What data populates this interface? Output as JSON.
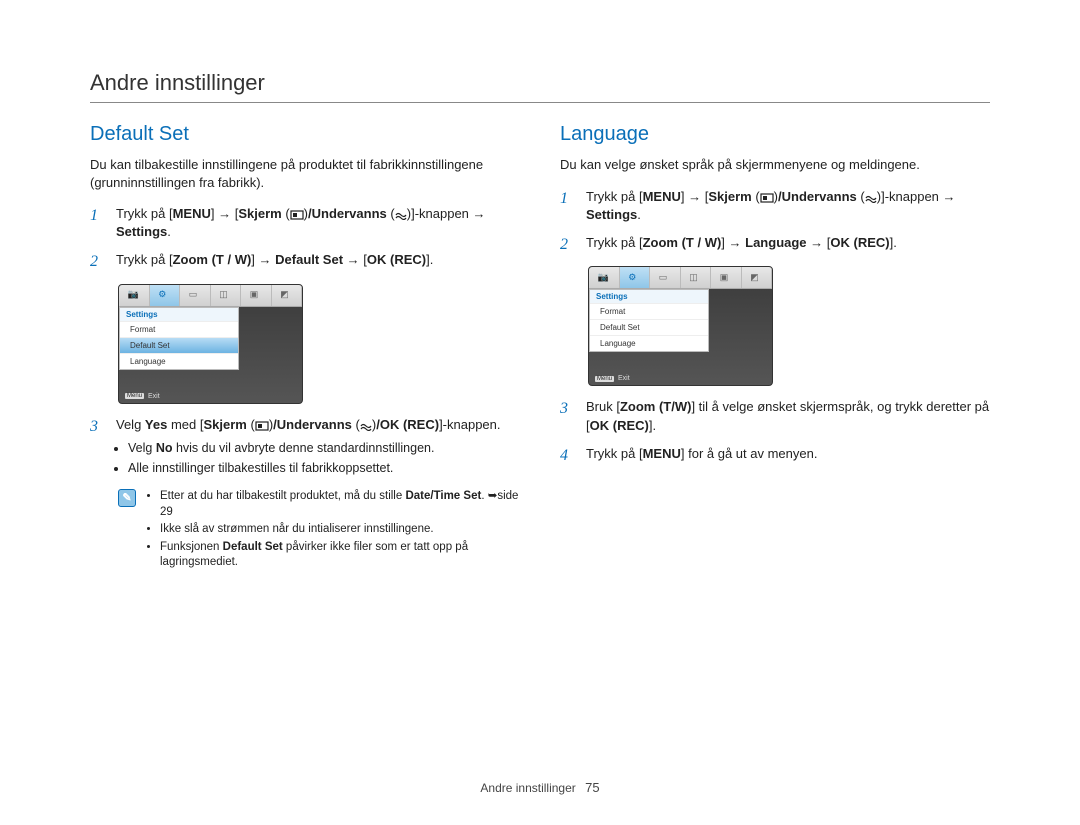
{
  "page_header": "Andre innstillinger",
  "footer": {
    "label": "Andre innstillinger",
    "page": "75"
  },
  "left": {
    "title": "Default Set",
    "intro": "Du kan tilbakestille innstillingene på produktet til fabrikkinnstillingene (grunninnstillingen fra fabrikk).",
    "step1_prefix": "Trykk på [",
    "menu": "MENU",
    "step1_mid1": "] → [",
    "skjerm": "Skjerm",
    "step1_underv": "/Undervanns",
    "step1_tail": "]-knappen → ",
    "settings": "Settings",
    "period": ".",
    "step2_prefix": "Trykk på [",
    "zoom": "Zoom (T / W)",
    "step2_mid": "] → ",
    "default_set": "Default Set",
    "step2_mid2": " → [",
    "okrec": "OK (REC)",
    "step2_tail": "].",
    "menu_label": "Settings",
    "menu_items": [
      "Format",
      "Default Set",
      "Language"
    ],
    "menu_selected": 1,
    "menu_exit": "Exit",
    "menu_exit_tag": "Menu",
    "step3_prefix": "Velg ",
    "yes": "Yes",
    "step3_mid": " med [",
    "step3_okrec": "/OK (REC)",
    "step3_tail": "]-knappen.",
    "step3_bullets": [
      {
        "pre": "Velg ",
        "bold": "No",
        "post": " hvis du vil avbryte denne standardinnstillingen."
      },
      {
        "text": "Alle innstillinger tilbakestilles til fabrikkoppsettet."
      }
    ],
    "notes": [
      {
        "pre": "Etter at du har tilbakestilt produktet, må du stille ",
        "bold": "Date/Time Set",
        "post": ". ➥side 29"
      },
      {
        "text": "Ikke slå av strømmen når du intialiserer innstillingene."
      },
      {
        "pre": "Funksjonen ",
        "bold": "Default Set",
        "post": " påvirker ikke filer som er tatt opp på lagringsmediet."
      }
    ]
  },
  "right": {
    "title": "Language",
    "intro": "Du kan velge ønsket språk på skjermmenyene og meldingene.",
    "step1_prefix": "Trykk på [",
    "menu": "MENU",
    "step1_mid1": "] → [",
    "skjerm": "Skjerm",
    "step1_underv": "/Undervanns",
    "step1_tail": "]-knappen → ",
    "settings": "Settings",
    "period": ".",
    "step2_prefix": "Trykk på [",
    "zoom": "Zoom (T / W)",
    "step2_mid": "] → ",
    "language": "Language",
    "step2_mid2": " → [",
    "okrec": "OK (REC)",
    "step2_tail": "].",
    "menu_label": "Settings",
    "menu_items": [
      "Format",
      "Default Set",
      "Language"
    ],
    "menu_selected": -1,
    "menu_exit": "Exit",
    "menu_exit_tag": "Menu",
    "step3_prefix": "Bruk [",
    "zoom2": "Zoom (T/W)",
    "step3_mid": "] til å velge ønsket skjermspråk, og trykk deretter på [",
    "okrec2": "OK (REC)",
    "step3_tail": "].",
    "step4_prefix": "Trykk på [",
    "menu2": "MENU",
    "step4_tail": "] for å gå ut av menyen."
  },
  "step_nums": {
    "s1": "1",
    "s2": "2",
    "s3": "3",
    "s4": "4"
  }
}
